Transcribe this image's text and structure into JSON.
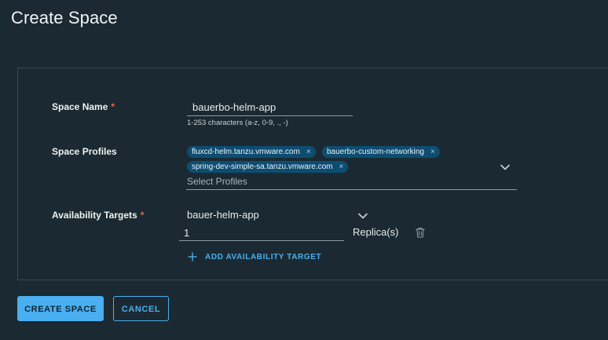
{
  "page": {
    "title": "Create Space"
  },
  "form": {
    "space_name": {
      "label": "Space Name",
      "required_mark": "*",
      "value": "bauerbo-helm-app",
      "helper": "1-253 characters (a-z, 0-9, ., -)"
    },
    "space_profiles": {
      "label": "Space Profiles",
      "chips": [
        "fluxcd-helm.tanzu.vmware.com",
        "bauerbo-custom-networking",
        "spring-dev-simple-sa.tanzu.vmware.com"
      ],
      "chip_remove_glyph": "×",
      "placeholder": "Select Profiles"
    },
    "availability_targets": {
      "label": "Availability Targets",
      "required_mark": "*",
      "selected_target": "bauer-helm-app",
      "replicas_value": "1",
      "replicas_label": "Replica(s)",
      "add_target_label": "ADD AVAILABILITY TARGET"
    }
  },
  "actions": {
    "create_label": "CREATE SPACE",
    "cancel_label": "CANCEL"
  },
  "colors": {
    "background": "#1b2a32",
    "accent": "#49aff0",
    "chip": "#0e4d72",
    "required": "#f35e4e"
  }
}
